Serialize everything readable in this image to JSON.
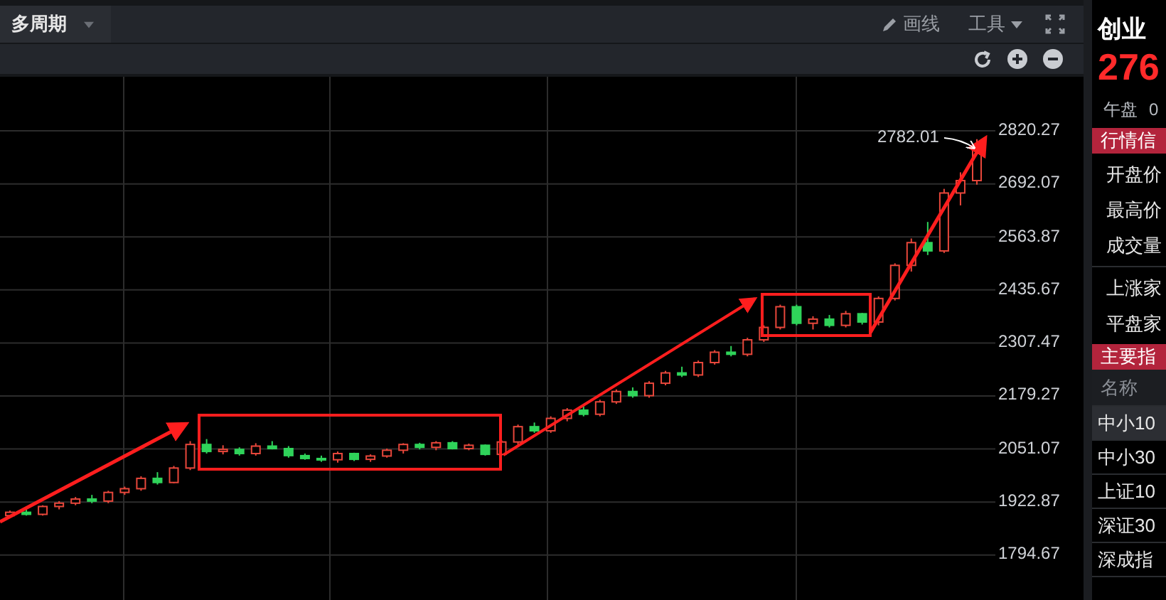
{
  "toolbar": {
    "period_selector": "多周期",
    "draw_button": "画线",
    "tools_menu": "工具"
  },
  "chart": {
    "callout": "2782.01",
    "chart_data": {
      "type": "candlestick",
      "ylim": [
        1679,
        2951
      ],
      "grid": true,
      "yticks": [
        {
          "value": 2820.27,
          "label": "2820.27"
        },
        {
          "value": 2692.07,
          "label": "2692.07"
        },
        {
          "value": 2563.87,
          "label": "2563.87"
        },
        {
          "value": 2435.67,
          "label": "2435.67"
        },
        {
          "value": 2307.47,
          "label": "2307.47"
        },
        {
          "value": 2179.27,
          "label": "2179.27"
        },
        {
          "value": 2051.07,
          "label": "2051.07"
        },
        {
          "value": 1922.87,
          "label": "1922.87"
        },
        {
          "value": 1794.67,
          "label": "1794.67"
        }
      ],
      "ohlc": [
        [
          1890,
          1902,
          1885,
          1898
        ],
        [
          1898,
          1908,
          1890,
          1893
        ],
        [
          1893,
          1915,
          1890,
          1912
        ],
        [
          1912,
          1925,
          1905,
          1920
        ],
        [
          1920,
          1935,
          1915,
          1930
        ],
        [
          1930,
          1940,
          1920,
          1925
        ],
        [
          1925,
          1950,
          1920,
          1946
        ],
        [
          1946,
          1960,
          1940,
          1955
        ],
        [
          1955,
          1985,
          1950,
          1980
        ],
        [
          1980,
          1995,
          1965,
          1970
        ],
        [
          1970,
          2010,
          1968,
          2005
        ],
        [
          2005,
          2070,
          2000,
          2062
        ],
        [
          2062,
          2075,
          2040,
          2045
        ],
        [
          2045,
          2060,
          2038,
          2050
        ],
        [
          2050,
          2055,
          2035,
          2040
        ],
        [
          2040,
          2065,
          2035,
          2058
        ],
        [
          2058,
          2070,
          2050,
          2052
        ],
        [
          2052,
          2058,
          2030,
          2035
        ],
        [
          2035,
          2040,
          2025,
          2028
        ],
        [
          2028,
          2035,
          2020,
          2025
        ],
        [
          2025,
          2045,
          2018,
          2040
        ],
        [
          2040,
          2042,
          2022,
          2026
        ],
        [
          2026,
          2038,
          2020,
          2034
        ],
        [
          2034,
          2052,
          2030,
          2048
        ],
        [
          2048,
          2065,
          2040,
          2062
        ],
        [
          2062,
          2066,
          2050,
          2055
        ],
        [
          2055,
          2070,
          2048,
          2066
        ],
        [
          2066,
          2070,
          2050,
          2052
        ],
        [
          2052,
          2064,
          2048,
          2060
        ],
        [
          2060,
          2062,
          2035,
          2038
        ],
        [
          2038,
          2072,
          2035,
          2068
        ],
        [
          2068,
          2110,
          2062,
          2105
        ],
        [
          2105,
          2115,
          2090,
          2095
        ],
        [
          2095,
          2130,
          2090,
          2125
        ],
        [
          2125,
          2150,
          2118,
          2145
        ],
        [
          2145,
          2158,
          2130,
          2135
        ],
        [
          2135,
          2170,
          2130,
          2165
        ],
        [
          2165,
          2195,
          2160,
          2190
        ],
        [
          2190,
          2200,
          2175,
          2180
        ],
        [
          2180,
          2215,
          2175,
          2210
        ],
        [
          2210,
          2240,
          2205,
          2235
        ],
        [
          2235,
          2250,
          2225,
          2230
        ],
        [
          2230,
          2265,
          2225,
          2260
        ],
        [
          2260,
          2290,
          2255,
          2285
        ],
        [
          2285,
          2300,
          2275,
          2280
        ],
        [
          2280,
          2320,
          2275,
          2315
        ],
        [
          2315,
          2350,
          2310,
          2345
        ],
        [
          2345,
          2400,
          2340,
          2395
        ],
        [
          2395,
          2400,
          2350,
          2355
        ],
        [
          2355,
          2372,
          2340,
          2365
        ],
        [
          2365,
          2375,
          2345,
          2350
        ],
        [
          2350,
          2385,
          2345,
          2378
        ],
        [
          2378,
          2380,
          2352,
          2358
        ],
        [
          2358,
          2420,
          2350,
          2415
        ],
        [
          2415,
          2500,
          2410,
          2495
        ],
        [
          2495,
          2560,
          2480,
          2550
        ],
        [
          2550,
          2600,
          2520,
          2530
        ],
        [
          2530,
          2680,
          2525,
          2670
        ],
        [
          2670,
          2720,
          2640,
          2700
        ],
        [
          2700,
          2800,
          2690,
          2782
        ]
      ]
    }
  },
  "quote_panel": {
    "title": "创业",
    "price": "276",
    "session": "午盘",
    "change": "0",
    "info_header": "行情信",
    "info_groups": [
      [
        "开盘价",
        "最高价",
        "成交量"
      ],
      [
        "上涨家",
        "平盘家"
      ]
    ],
    "index_header": "主要指",
    "index_table": {
      "columns": [
        "名称"
      ],
      "rows": [
        {
          "name": "中小10",
          "selected": true
        },
        {
          "name": "中小30",
          "selected": false
        },
        {
          "name": "上证10",
          "selected": false
        },
        {
          "name": "深证30",
          "selected": false
        },
        {
          "name": "深成指",
          "selected": false
        }
      ]
    }
  }
}
